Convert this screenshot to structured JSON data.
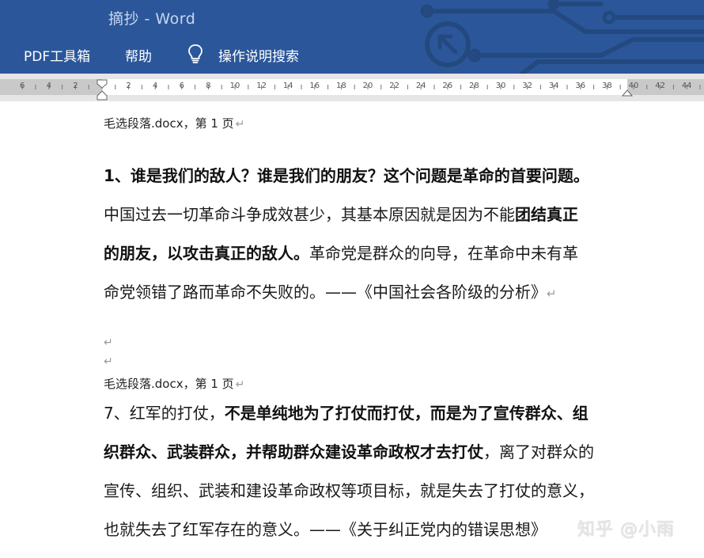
{
  "titlebar": {
    "title": "摘抄  -  Word",
    "menu": {
      "pdf_tools": "PDF工具箱",
      "help": "帮助",
      "tell_me": "操作说明搜索"
    },
    "icons": [
      "lightbulb-icon"
    ],
    "background_color": "#2b579a"
  },
  "ruler": {
    "numbers": [
      "6",
      "4",
      "2",
      "2",
      "4",
      "6",
      "8",
      "10",
      "12",
      "14",
      "16",
      "18",
      "20",
      "22",
      "24",
      "26",
      "28",
      "30",
      "32",
      "34",
      "36",
      "38",
      "40",
      "42",
      "44"
    ]
  },
  "document": {
    "block1": {
      "source_label": "毛选段落.docx，第 1 页",
      "line1_bold": "1、谁是我们的敌人？谁是我们的朋友？这个问题是革命的首要问题。",
      "line2_normal": "中国过去一切革命斗争成效甚少，其基本原因就是因为不能",
      "line2_bold": "团结真正",
      "line3_bold": "的朋友，以攻击真正的敌人。",
      "line3_normal": "革命党是群众的向导，在革命中未有革",
      "line4_normal": "命党领错了路而革命不失败的。——《中国社会各阶级的分析》"
    },
    "block2": {
      "source_label": "毛选段落.docx，第 1 页",
      "line1_normal": "7、红军的打仗，",
      "line1_bold": "不是单纯地为了打仗而打仗，而是为了宣传群众、组",
      "line2_bold": "织群众、武装群众，并帮助群众建设革命政权才去打仗",
      "line2_normal": "，离了对群众的",
      "line3_normal": "宣传、组织、武装和建设革命政权等项目标，就是失去了打仗的意义，",
      "line4_normal": "也就失去了红军存在的意义。——《关于纠正党内的错误思想》"
    },
    "paragraph_mark": "↵",
    "watermark": "知乎 @小雨"
  }
}
